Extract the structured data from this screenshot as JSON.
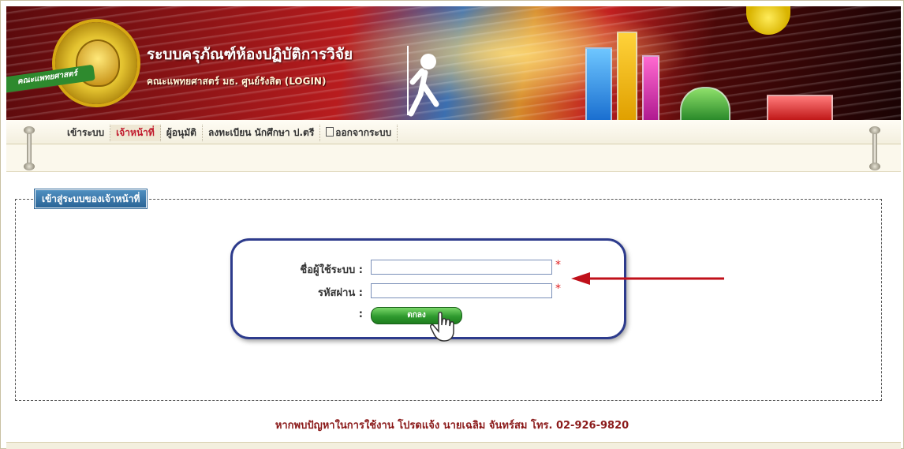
{
  "header": {
    "title": "ระบบครุภัณฑ์ห้องปฏิบัติการวิจัย",
    "subtitle": "คณะแพทยศาสตร์ มธ. ศูนย์รังสิต (LOGIN)",
    "logo_ribbon": "คณะแพทยศาสตร์"
  },
  "menu": {
    "items": [
      {
        "label": "เข้าระบบ",
        "active": false
      },
      {
        "label": "เจ้าหน้าที่",
        "active": true
      },
      {
        "label": "ผู้อนุมัติ",
        "active": false
      },
      {
        "label": "ลงทะเบียน นักศึกษา ป.ตรี",
        "active": false
      },
      {
        "label": "ออกจากระบบ",
        "active": false,
        "icon": "exit-icon"
      }
    ]
  },
  "login": {
    "section_title": "เข้าสู่ระบบของเจ้าหน้าที่",
    "username_label": "ชื่อผู้ใช้ระบบ :",
    "username_value": "",
    "password_label": "รหัสผ่าน :",
    "password_value": "",
    "required_mark": "*",
    "submit_colon": ":",
    "submit_label": "ตกลง"
  },
  "footer": {
    "note": "หากพบปัญหาในการใช้งาน โปรดแจ้ง นายเฉลิม จันทร์สม โทร. 02-926-9820"
  },
  "colors": {
    "accent_red": "#c0182b",
    "login_border": "#2d3b8c",
    "button_green": "#2f9a2f",
    "arrow_red": "#c0101a"
  }
}
